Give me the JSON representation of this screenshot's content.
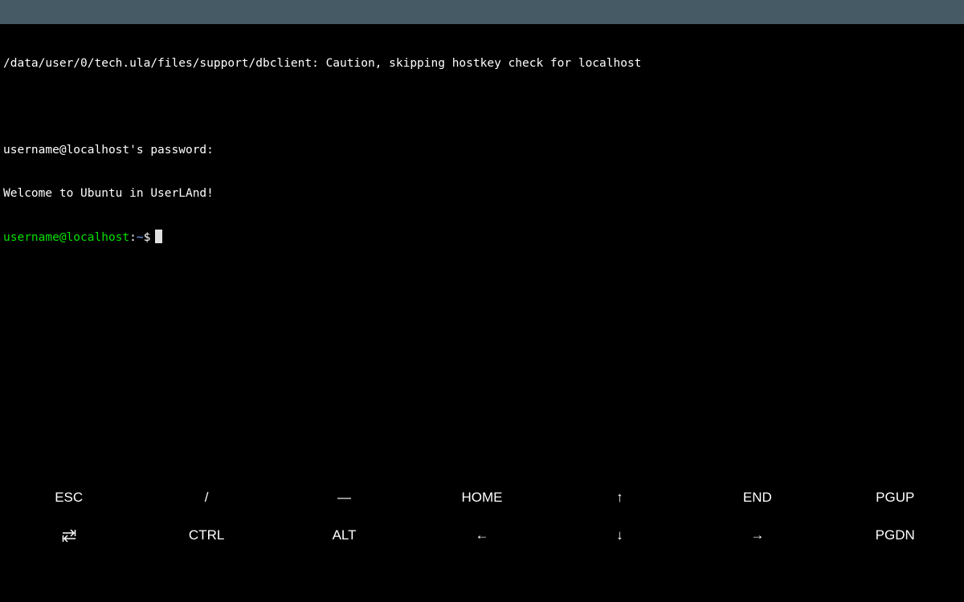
{
  "terminal": {
    "line1": "/data/user/0/tech.ula/files/support/dbclient: Caution, skipping hostkey check for localhost",
    "line2": "",
    "line3": "username@localhost's password:",
    "line4": "Welcome to Ubuntu in UserLAnd!",
    "prompt": {
      "user_host": "username@localhost",
      "separator": ":",
      "path": "~",
      "symbol": "$"
    },
    "colors": {
      "background": "#000000",
      "text": "#ffffff",
      "prompt_user": "#00e000",
      "prompt_path": "#6fa6ff"
    }
  },
  "status_bar": {
    "color": "#455a64"
  },
  "extra_keys": {
    "row1": [
      "ESC",
      "/",
      "—",
      "HOME",
      "↑",
      "END",
      "PGUP"
    ],
    "row2": {
      "tab_icon": "tab-arrows-icon",
      "ctrl": "CTRL",
      "alt": "ALT",
      "left": "←",
      "down": "↓",
      "right": "→",
      "pgdn": "PGDN"
    }
  }
}
